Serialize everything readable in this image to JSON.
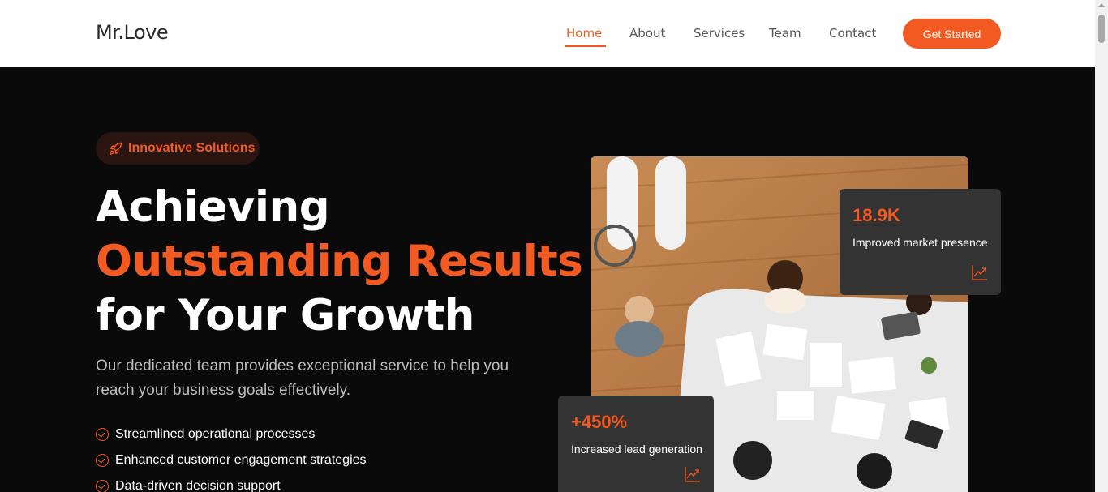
{
  "header": {
    "logo": "Mr.Love",
    "nav": [
      "Home",
      "About",
      "Services",
      "Team",
      "Contact"
    ],
    "active_nav": "Home",
    "cta_label": "Get Started"
  },
  "hero": {
    "badge": "Innovative Solutions",
    "headline_line1": "Achieving",
    "headline_line2": "Outstanding Results",
    "headline_line3": "for Your Growth",
    "subtitle": "Our dedicated team provides exceptional service to help you reach your business goals effectively.",
    "features": [
      "Streamlined operational processes",
      "Enhanced customer engagement strategies",
      "Data-driven decision support"
    ]
  },
  "stats": [
    {
      "value": "18.9K",
      "label": "Improved market presence",
      "icon": "trend-chart-icon"
    },
    {
      "value": "+450%",
      "label": "Increased lead generation",
      "icon": "trend-chart-icon"
    }
  ],
  "colors": {
    "accent": "#f35a21",
    "background": "#0a0a0a",
    "card": "#333333"
  }
}
